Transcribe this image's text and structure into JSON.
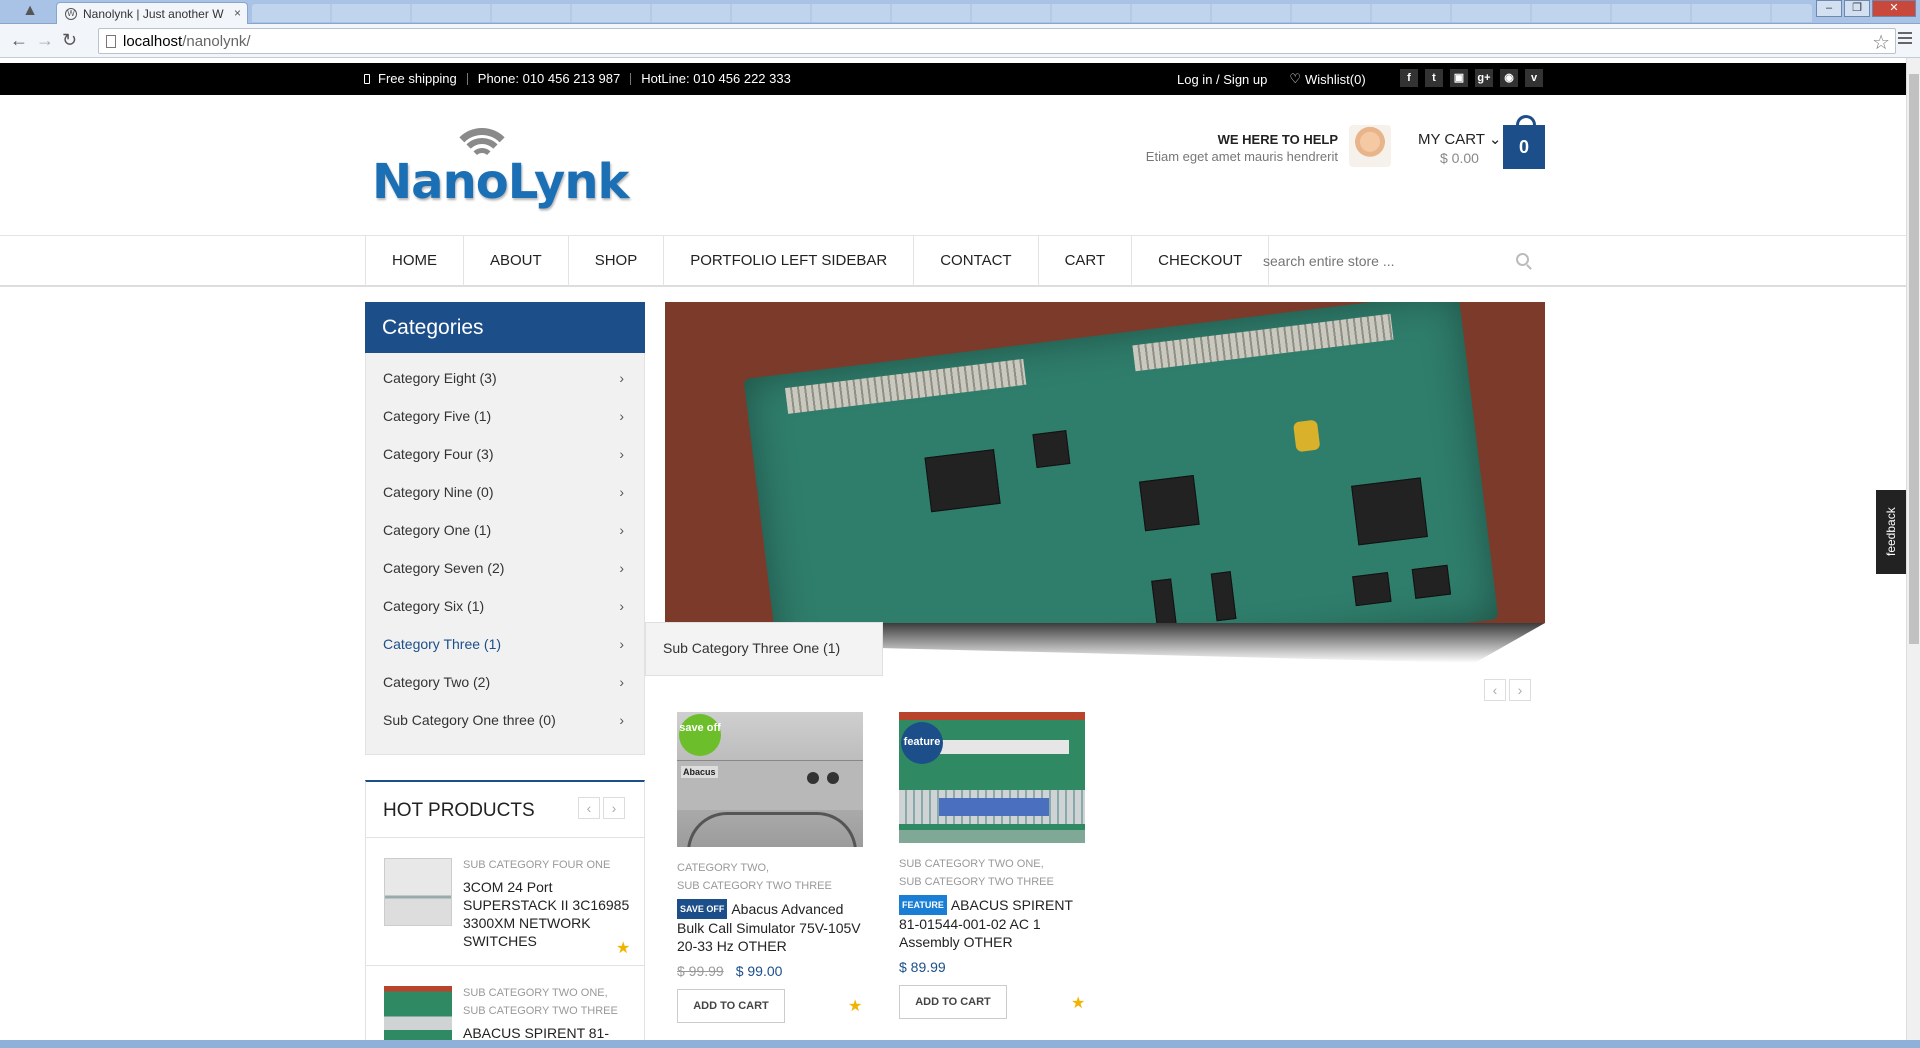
{
  "browser": {
    "tab_title": "Nanolynk | Just another W",
    "url_host": "localhost",
    "url_path": "/nanolynk/"
  },
  "topbar": {
    "free_shipping": "Free shipping",
    "phone": "Phone: 010 456 213 987",
    "hotline": "HotLine: 010 456 222 333",
    "login": "Log in / Sign up",
    "wishlist": "Wishlist(0)",
    "socials": [
      "f",
      "t",
      "▣",
      "g+",
      "◉",
      "v"
    ]
  },
  "header": {
    "logo_text": "NanoLynk",
    "help_title": "WE HERE TO HELP",
    "help_sub": "Etiam eget amet mauris hendrerit",
    "cart_label": "MY CART",
    "cart_total": "$ 0.00",
    "cart_count": "0"
  },
  "nav": {
    "items": [
      "HOME",
      "ABOUT",
      "SHOP",
      "PORTFOLIO LEFT SIDEBAR",
      "CONTACT",
      "CART",
      "CHECKOUT"
    ],
    "search_placeholder": "search entire store ..."
  },
  "categories": {
    "title": "Categories",
    "items": [
      "Category Eight (3)",
      "Category Five (1)",
      "Category Four (3)",
      "Category Nine (0)",
      "Category One (1)",
      "Category Seven (2)",
      "Category Six (1)",
      "Category Three (1)",
      "Category Two (2)",
      "Sub Category One three (0)"
    ],
    "submenu": "Sub Category Three One (1)"
  },
  "products": [
    {
      "badge": "save off",
      "badge_color": "#6cbf2a",
      "cats_line1": "CATEGORY TWO,",
      "cats_line2": "SUB CATEGORY TWO THREE",
      "tag": "SAVE OFF",
      "name": "Abacus Advanced Bulk Call Simulator 75V-105V 20-33 Hz OTHER",
      "old_price": "$ 99.99",
      "price": "$ 99.00",
      "button": "ADD TO CART"
    },
    {
      "badge": "feature",
      "badge_color": "#1c4f8a",
      "cats_line1": "SUB CATEGORY TWO ONE,",
      "cats_line2": "SUB CATEGORY TWO THREE",
      "tag": "FEATURE",
      "name": "ABACUS SPIRENT 81-01544-001-02 AC 1 Assembly OTHER",
      "price": "$ 89.99",
      "button": "ADD TO CART"
    }
  ],
  "hot_products": {
    "title": "HOT PRODUCTS",
    "items": [
      {
        "cats_line1": "SUB CATEGORY FOUR ONE",
        "cats_line2": "",
        "name": "3COM 24 Port SUPERSTACK II 3C16985 3300XM NETWORK SWITCHES"
      },
      {
        "cats_line1": "SUB CATEGORY TWO ONE,",
        "cats_line2": "SUB CATEGORY TWO THREE",
        "name": "ABACUS SPIRENT 81-"
      }
    ]
  },
  "feedback": "feedback",
  "colors": {
    "brand": "#1c4f8a",
    "topbar": "#000000",
    "star": "#f0b400"
  }
}
